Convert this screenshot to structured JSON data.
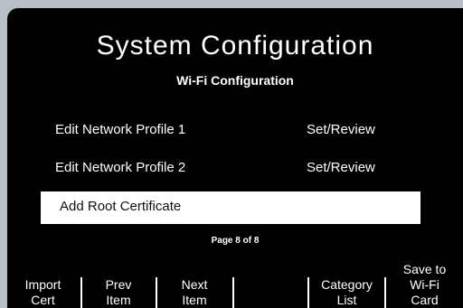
{
  "screen": {
    "title": "System Configuration",
    "subtitle": "Wi-Fi Configuration",
    "menu": [
      {
        "label": "Edit Network Profile 1",
        "value": "Set/Review"
      },
      {
        "label": "Edit Network Profile 2",
        "value": "Set/Review"
      },
      {
        "label": "Add Root Certificate",
        "value": ""
      }
    ],
    "page_info": "Page 8 of 8"
  },
  "softkeys": [
    {
      "line1": "Import",
      "line2": "Cert"
    },
    {
      "line1": "Prev",
      "line2": "Item"
    },
    {
      "line1": "Next",
      "line2": "Item"
    },
    {
      "line1": "",
      "line2": ""
    },
    {
      "line1": "Category",
      "line2": "List"
    },
    {
      "line0": "Save to",
      "line1": "Wi-Fi",
      "line2": "Card"
    }
  ]
}
